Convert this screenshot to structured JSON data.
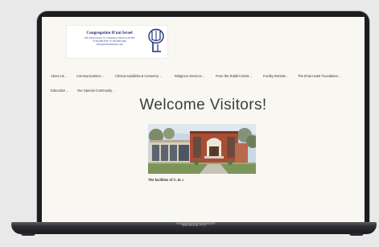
{
  "device": {
    "brand": "MacBook Pro"
  },
  "logo": {
    "name": "Congregation B'nai Israel",
    "address": "190 Church Street, St. Catharines, Ontario L2R 3E8",
    "phone": "T: 905.685.6767  |  F: 905.685.3346",
    "email": "office@cbistcatharines.com"
  },
  "nav": {
    "row1": [
      "About Us",
      "Communications",
      "Chevra Kaddisha & Cemetery",
      "Religious Services",
      "From the Rabbi's Desk",
      "Facility Rentals",
      "The B'nai Israel Foundation"
    ],
    "row2": [
      "Education",
      "Our Special Community"
    ],
    "chevron": "⌄"
  },
  "main": {
    "heading": "Welcome Visitors!",
    "caption": "The facilities of C. B. I."
  },
  "colors": {
    "logo_text": "#1f2e7a",
    "page_bg": "#f8f7f2",
    "brick": "#a94e36",
    "sky": "#c9d8e6"
  }
}
